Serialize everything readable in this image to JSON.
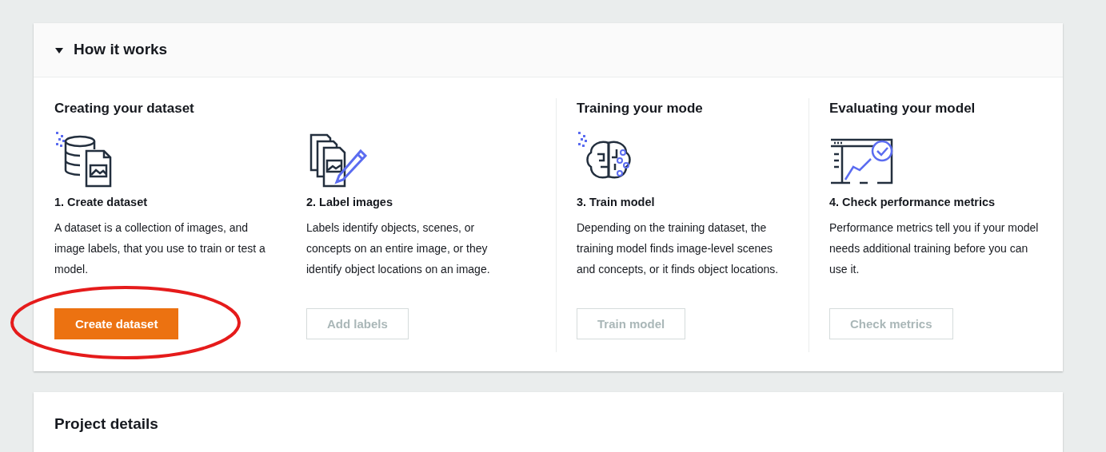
{
  "how_it_works": {
    "title": "How it works",
    "expanded": true,
    "groups": [
      {
        "title": "Creating your dataset",
        "steps": [
          {
            "title": "1. Create dataset",
            "description": "A dataset is a collection of images, and image labels, that you use to train or test a model.",
            "button": {
              "label": "Create dataset",
              "disabled": false,
              "highlighted": true
            }
          },
          {
            "title": "2. Label images",
            "description": "Labels identify objects, scenes, or concepts on an entire image, or they identify object locations on an image.",
            "button": {
              "label": "Add labels",
              "disabled": true,
              "highlighted": false
            }
          }
        ]
      },
      {
        "title": "Training your mode",
        "steps": [
          {
            "title": "3. Train model",
            "description": "Depending on the training dataset, the training model finds image-level scenes and concepts, or it finds object locations.",
            "button": {
              "label": "Train model",
              "disabled": true,
              "highlighted": false
            }
          }
        ]
      },
      {
        "title": "Evaluating your model",
        "steps": [
          {
            "title": "4. Check performance metrics",
            "description": "Performance metrics tell you if your model needs additional training before you can use it.",
            "button": {
              "label": "Check metrics",
              "disabled": true,
              "highlighted": false
            }
          }
        ]
      }
    ]
  },
  "project_details": {
    "title": "Project details"
  }
}
